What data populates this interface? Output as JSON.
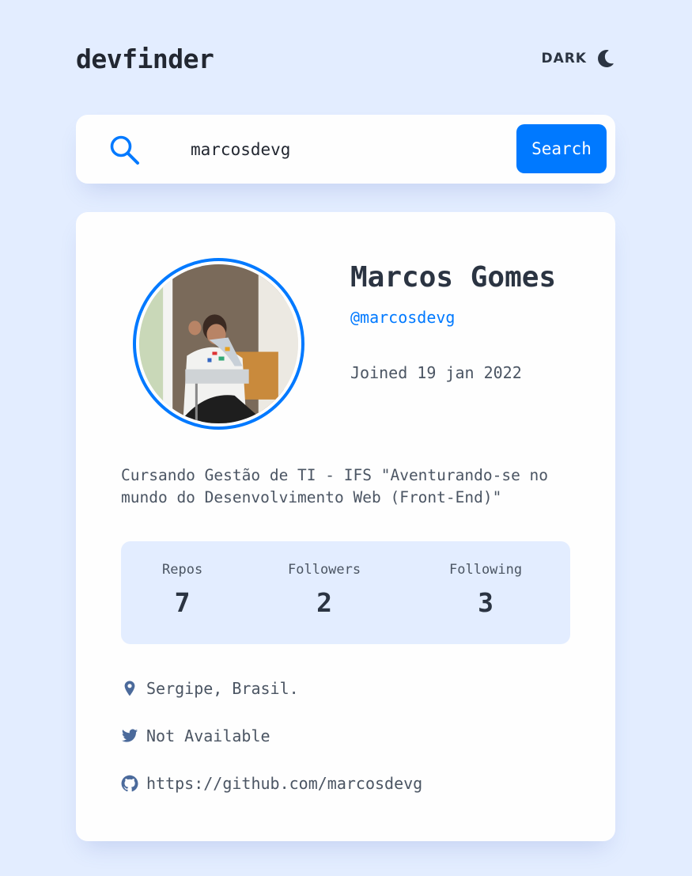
{
  "header": {
    "logo": "devfinder",
    "theme_label": "DARK",
    "theme_icon": "moon-icon"
  },
  "search": {
    "icon": "search-icon",
    "value": "marcosdevg",
    "button_label": "Search"
  },
  "profile": {
    "name": "Marcos Gomes",
    "login": "@marcosdevg",
    "joined": "Joined 19 jan 2022",
    "bio": "Cursando Gestão de TI - IFS \"Aventurando-se no mundo do Desenvolvimento Web (Front-End)\"",
    "stats": [
      {
        "label": "Repos",
        "value": "7"
      },
      {
        "label": "Followers",
        "value": "2"
      },
      {
        "label": "Following",
        "value": "3"
      }
    ],
    "links": {
      "location": {
        "icon": "location-pin-icon",
        "text": "Sergipe, Brasil."
      },
      "twitter": {
        "icon": "twitter-icon",
        "text": "Not Available"
      },
      "github": {
        "icon": "github-icon",
        "text": "https://github.com/marcosdevg"
      }
    }
  },
  "colors": {
    "background": "#e3edff",
    "card": "#fefefe",
    "accent": "#0079ff",
    "heading": "#2b3442",
    "body_text": "#4b5563",
    "icon": "#4b6a9b"
  }
}
